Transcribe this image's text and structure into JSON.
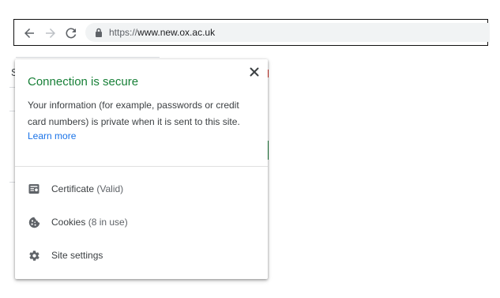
{
  "browser": {
    "url_scheme": "https://",
    "url_host": "www.new.ox.ac.uk",
    "icons": {
      "back": "arrow-left-icon",
      "forward": "arrow-right-icon",
      "reload": "reload-icon",
      "lock": "lock-icon"
    }
  },
  "page_behind": {
    "partial_text": "S"
  },
  "site_info": {
    "title": "Connection is secure",
    "description": "Your information (for example, passwords or credit card numbers) is private when it is sent to this site.",
    "learn_more": "Learn more",
    "close_icon": "close-icon",
    "rows": [
      {
        "label": "Certificate",
        "detail": "(Valid)",
        "icon": "certificate-icon"
      },
      {
        "label": "Cookies",
        "detail": "(8 in use)",
        "icon": "cookie-icon"
      },
      {
        "label": "Site settings",
        "detail": "",
        "icon": "gear-icon"
      }
    ],
    "colors": {
      "title": "#188038",
      "link": "#1a73e8",
      "text": "#3c4043"
    }
  }
}
